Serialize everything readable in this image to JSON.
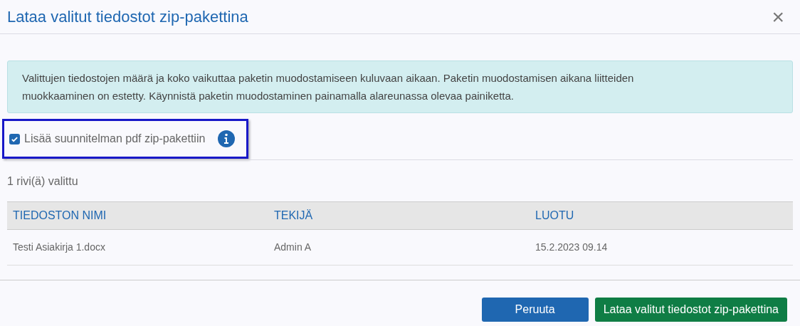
{
  "dialog": {
    "title": "Lataa valitut tiedostot zip-pakettina",
    "close": "×"
  },
  "notice": "Valittujen tiedostojen määrä ja koko vaikuttaa paketin muodostamiseen kuluvaan aikaan. Paketin muodostamisen aikana liitteiden muokkaaminen on estetty. Käynnistä paketin muodostaminen painamalla alareunassa olevaa painiketta.",
  "option": {
    "label": "Lisää suunnitelman pdf zip-pakettiin",
    "checked": true,
    "focused": true
  },
  "selection_count": "1 rivi(ä) valittu",
  "table": {
    "columns": [
      "TIEDOSTON NIMI",
      "TEKIJÄ",
      "LUOTU"
    ],
    "rows": [
      [
        "Testi Asiakirja 1.docx",
        "Admin A",
        "15.2.2023 09.14"
      ]
    ]
  },
  "buttons": [
    {
      "label": "Peruuta",
      "kind": "secondary"
    },
    {
      "label": "Lataa valitut tiedostot zip-pakettina",
      "kind": "primary"
    }
  ]
}
